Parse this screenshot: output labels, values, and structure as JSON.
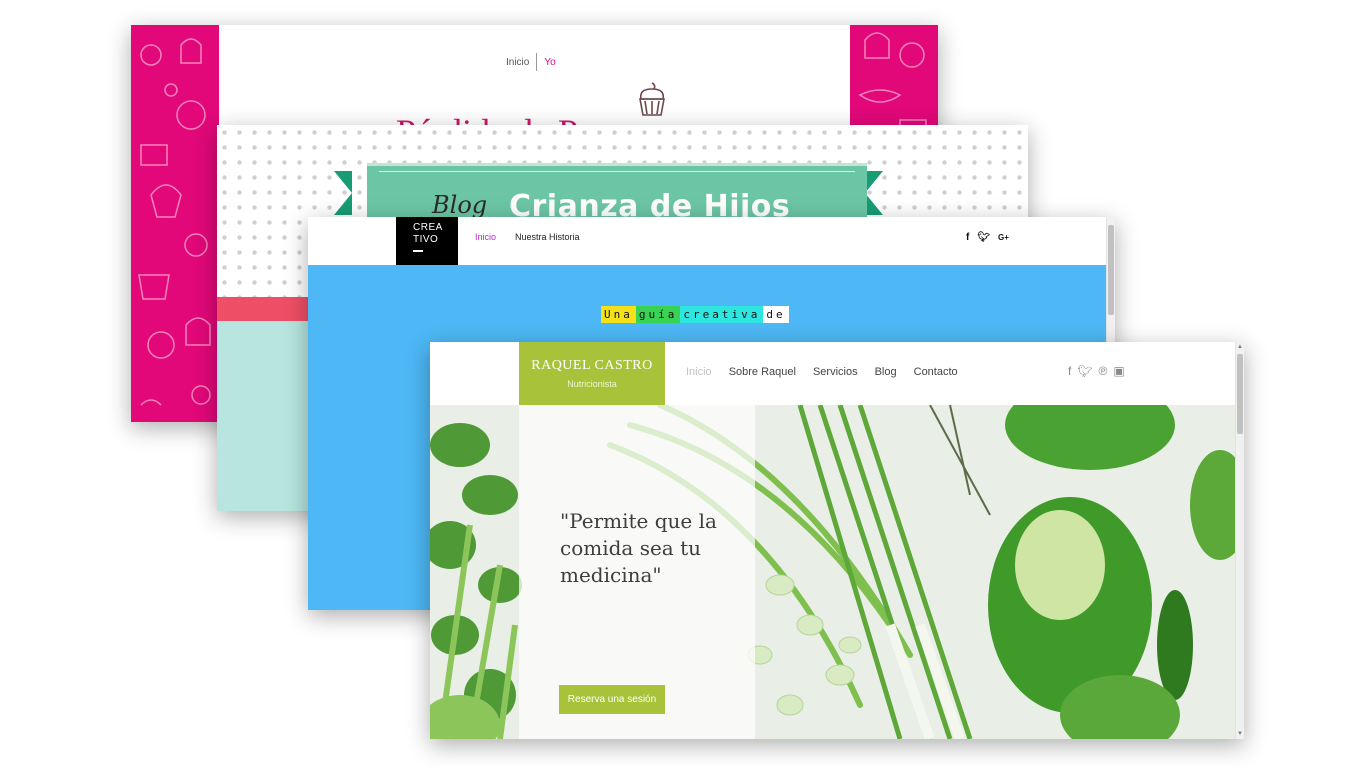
{
  "window_pastry": {
    "nav": {
      "home": "Inicio",
      "about": "Yo"
    },
    "title": "Pérdida de P"
  },
  "window_crianza": {
    "blog_script": "Blog",
    "title": "Crianza de Hijos"
  },
  "window_creativo": {
    "logo_line1": "CREA",
    "logo_line2": "TIVO",
    "nav": {
      "home": "Inicio",
      "story": "Nuestra Historia"
    },
    "social": [
      "facebook-icon",
      "twitter-icon",
      "google-plus-icon"
    ],
    "guide_words": [
      {
        "text": "Una",
        "color": "#f5e11b"
      },
      {
        "text": "guía",
        "color": "#39d353"
      },
      {
        "text": "creativa",
        "color": "#2ee6e0"
      },
      {
        "text": "de",
        "color": "#ffffff"
      }
    ]
  },
  "window_raquel": {
    "brand_name": "RAQUEL CASTRO",
    "brand_role": "Nutricionista",
    "menu": {
      "home": "Inicio",
      "about": "Sobre Raquel",
      "services": "Servicios",
      "blog": "Blog",
      "contact": "Contacto"
    },
    "social": [
      "facebook-icon",
      "twitter-icon",
      "pinterest-icon",
      "instagram-icon"
    ],
    "quote": "\"Permite que la comida sea tu medicina\"",
    "cta": "Reserva una sesión",
    "accent_color": "#a8c23a"
  }
}
